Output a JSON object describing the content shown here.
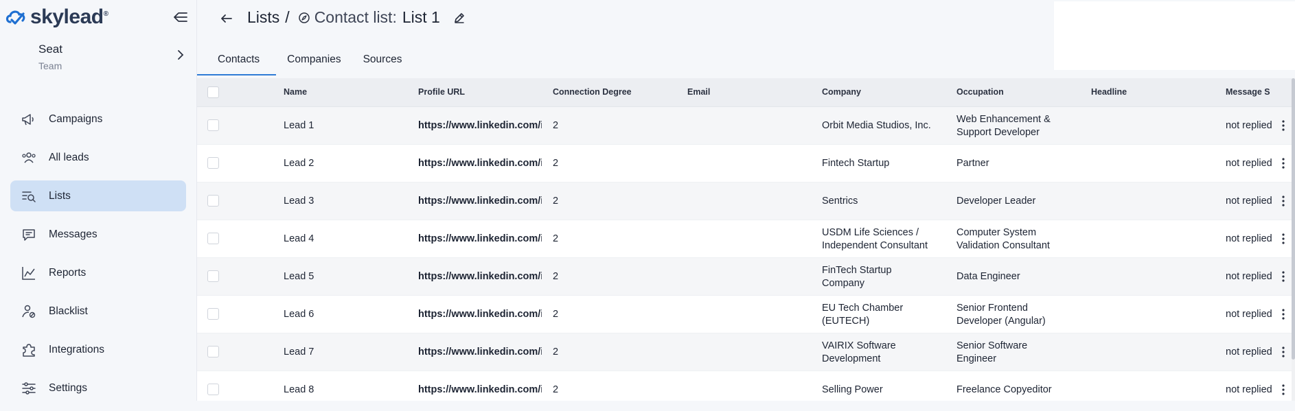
{
  "app": {
    "logo_text": "skylead",
    "logo_reg": "®",
    "brand_color": "#1e6fd1"
  },
  "seat": {
    "name": "Seat",
    "team": "Team"
  },
  "sidebar": {
    "items": [
      {
        "label": "Campaigns",
        "icon": "megaphone-icon",
        "active": false
      },
      {
        "label": "All leads",
        "icon": "users-icon",
        "active": false
      },
      {
        "label": "Lists",
        "icon": "list-search-icon",
        "active": true
      },
      {
        "label": "Messages",
        "icon": "message-icon",
        "active": false
      },
      {
        "label": "Reports",
        "icon": "chart-icon",
        "active": false
      },
      {
        "label": "Blacklist",
        "icon": "user-block-icon",
        "active": false
      },
      {
        "label": "Integrations",
        "icon": "puzzle-icon",
        "active": false
      },
      {
        "label": "Settings",
        "icon": "sliders-icon",
        "active": false
      }
    ]
  },
  "header": {
    "lists": "Lists",
    "slash": "/",
    "contact_list_label": "Contact list:",
    "list_name": "List 1"
  },
  "tabs": [
    {
      "label": "Contacts",
      "active": true
    },
    {
      "label": "Companies",
      "active": false
    },
    {
      "label": "Sources",
      "active": false
    }
  ],
  "table": {
    "columns": [
      "Name",
      "Profile URL",
      "Connection Degree",
      "Email",
      "Company",
      "Occupation",
      "Headline",
      "Message S"
    ],
    "rows": [
      {
        "name": "Lead 1",
        "url": "https://www.linkedin.com/in/",
        "degree": "2",
        "email": "",
        "company": [
          "Orbit Media Studios, Inc."
        ],
        "occupation": [
          "Web Enhancement &",
          "Support Developer"
        ],
        "headline": "",
        "status": "not replied"
      },
      {
        "name": "Lead 2",
        "url": "https://www.linkedin.com/in/",
        "degree": "2",
        "email": "",
        "company": [
          "Fintech Startup"
        ],
        "occupation": [
          "Partner"
        ],
        "headline": "",
        "status": "not replied"
      },
      {
        "name": "Lead 3",
        "url": "https://www.linkedin.com/in/",
        "degree": "2",
        "email": "",
        "company": [
          "Sentrics"
        ],
        "occupation": [
          "Developer Leader"
        ],
        "headline": "",
        "status": "not replied"
      },
      {
        "name": "Lead 4",
        "url": "https://www.linkedin.com/in/",
        "degree": "2",
        "email": "",
        "company": [
          "USDM Life Sciences /",
          "Independent Consultant"
        ],
        "occupation": [
          "Computer System",
          "Validation Consultant"
        ],
        "headline": "",
        "status": "not replied"
      },
      {
        "name": "Lead 5",
        "url": "https://www.linkedin.com/in/",
        "degree": "2",
        "email": "",
        "company": [
          "FinTech Startup",
          "Company"
        ],
        "occupation": [
          "Data Engineer"
        ],
        "headline": "",
        "status": "not replied"
      },
      {
        "name": "Lead 6",
        "url": "https://www.linkedin.com/in/",
        "degree": "2",
        "email": "",
        "company": [
          "EU Tech Chamber",
          "(EUTECH)"
        ],
        "occupation": [
          "Senior Frontend",
          "Developer (Angular)"
        ],
        "headline": "",
        "status": "not replied"
      },
      {
        "name": "Lead 7",
        "url": "https://www.linkedin.com/in/",
        "degree": "2",
        "email": "",
        "company": [
          "VAIRIX Software",
          "Development"
        ],
        "occupation": [
          "Senior Software",
          "Engineer"
        ],
        "headline": "",
        "status": "not replied"
      },
      {
        "name": "Lead 8",
        "url": "https://www.linkedin.com/in/",
        "degree": "2",
        "email": "",
        "company": [
          "Selling Power"
        ],
        "occupation": [
          "Freelance Copyeditor"
        ],
        "headline": "",
        "status": "not replied"
      }
    ]
  }
}
